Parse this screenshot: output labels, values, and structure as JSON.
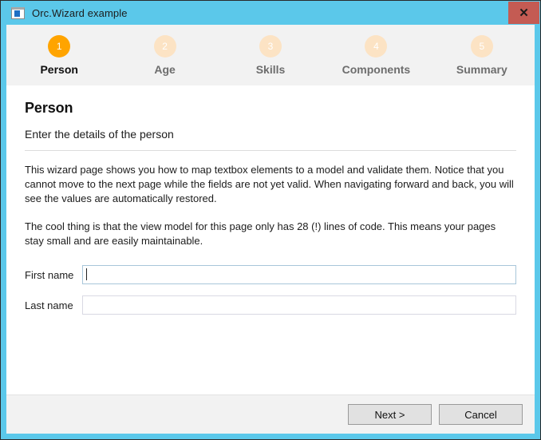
{
  "window": {
    "title": "Orc.Wizard example",
    "icon": "app-window-icon",
    "close_label": "✕",
    "chrome_color": "#5bc8ea",
    "close_color": "#c45b53"
  },
  "steps": {
    "active_index": 0,
    "active_color": "#ffa400",
    "inactive_color": "#fce3c4",
    "items": [
      {
        "number": "1",
        "label": "Person"
      },
      {
        "number": "2",
        "label": "Age"
      },
      {
        "number": "3",
        "label": "Skills"
      },
      {
        "number": "4",
        "label": "Components"
      },
      {
        "number": "5",
        "label": "Summary"
      }
    ]
  },
  "page": {
    "title": "Person",
    "subtitle": "Enter the details of the person",
    "paragraphs": [
      "This wizard page shows you how to map textbox elements to a model and validate them. Notice that you cannot move to the next page while the fields are not yet valid. When navigating forward and back, you will see the values are automatically restored.",
      "The cool thing is that the view model for this page only has 28 (!) lines of code. This means your pages stay small and are easily maintainable."
    ]
  },
  "form": {
    "fields": [
      {
        "label": "First name",
        "value": "",
        "placeholder": "",
        "focused": true
      },
      {
        "label": "Last name",
        "value": "",
        "placeholder": "",
        "focused": false
      }
    ]
  },
  "footer": {
    "next_label": "Next >",
    "cancel_label": "Cancel"
  }
}
